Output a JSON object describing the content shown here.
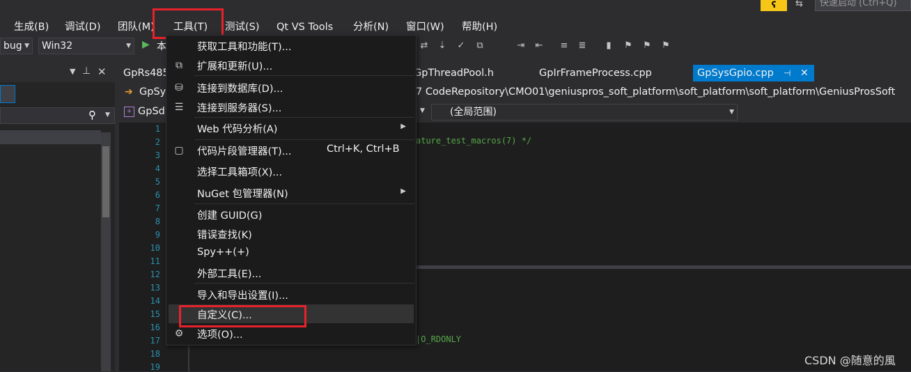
{
  "quicklaunch": {
    "placeholder": "快速启动 (Ctrl+Q)"
  },
  "menubar": {
    "items": [
      "生成(B)",
      "调试(D)",
      "团队(M)",
      "工具(T)",
      "测试(S)",
      "Qt VS Tools",
      "分析(N)",
      "窗口(W)",
      "帮助(H)"
    ]
  },
  "toolbar": {
    "config_value": "bug",
    "platform_value": "Win32",
    "run_label": "本"
  },
  "tabs": [
    {
      "label": "GpRs485"
    },
    {
      "label": "GpThreadPool.h"
    },
    {
      "label": "GpIrFrameProcess.cpp"
    },
    {
      "label": "GpSysGpio.cpp",
      "active": true
    }
  ],
  "nav": {
    "file_label": "GpSy",
    "path": "7 CodeRepository\\CMO01\\geniuspros_soft_platform\\soft_platform\\soft_platform\\GeniusProsSoft",
    "scope_file": "GpSd",
    "scope": "(全局范围)"
  },
  "editor": {
    "line_numbers": [
      "1",
      "2",
      "3",
      "4",
      "5",
      "6",
      "7",
      "8",
      "9",
      "10",
      "11",
      "12",
      "13",
      "14",
      "15",
      "16",
      "17",
      "18",
      "19"
    ],
    "code_line2": "ature_test_macros(7) */",
    "code_line17": "|O_RDONLY"
  },
  "tools_menu": {
    "items": [
      {
        "label": "获取工具和功能(T)...",
        "shortcut": "",
        "submenu": false,
        "icon": ""
      },
      {
        "label": "扩展和更新(U)...",
        "shortcut": "",
        "submenu": false,
        "icon": "extensions-icon"
      },
      {
        "label": "连接到数据库(D)...",
        "shortcut": "",
        "submenu": false,
        "icon": "database-icon"
      },
      {
        "label": "连接到服务器(S)...",
        "shortcut": "",
        "submenu": false,
        "icon": "server-icon"
      },
      {
        "label": "Web 代码分析(A)",
        "shortcut": "",
        "submenu": true,
        "icon": ""
      },
      {
        "label": "代码片段管理器(T)...",
        "shortcut": "Ctrl+K, Ctrl+B",
        "submenu": false,
        "icon": "snippet-icon"
      },
      {
        "label": "选择工具箱项(X)...",
        "shortcut": "",
        "submenu": false,
        "icon": ""
      },
      {
        "label": "NuGet 包管理器(N)",
        "shortcut": "",
        "submenu": true,
        "icon": ""
      },
      {
        "label": "创建 GUID(G)",
        "shortcut": "",
        "submenu": false,
        "icon": ""
      },
      {
        "label": "错误查找(K)",
        "shortcut": "",
        "submenu": false,
        "icon": ""
      },
      {
        "label": "Spy++(+)",
        "shortcut": "",
        "submenu": false,
        "icon": ""
      },
      {
        "label": "外部工具(E)...",
        "shortcut": "",
        "submenu": false,
        "icon": ""
      },
      {
        "label": "导入和导出设置(I)...",
        "shortcut": "",
        "submenu": false,
        "icon": ""
      },
      {
        "label": "自定义(C)...",
        "shortcut": "",
        "submenu": false,
        "icon": ""
      },
      {
        "label": "选项(O)...",
        "shortcut": "",
        "submenu": false,
        "icon": "gear-icon"
      }
    ]
  },
  "watermark": "CSDN @随意的風",
  "colors": {
    "accent": "#007acc",
    "highlight_border": "#e8222b",
    "menu_bg": "#1b1b1c"
  }
}
